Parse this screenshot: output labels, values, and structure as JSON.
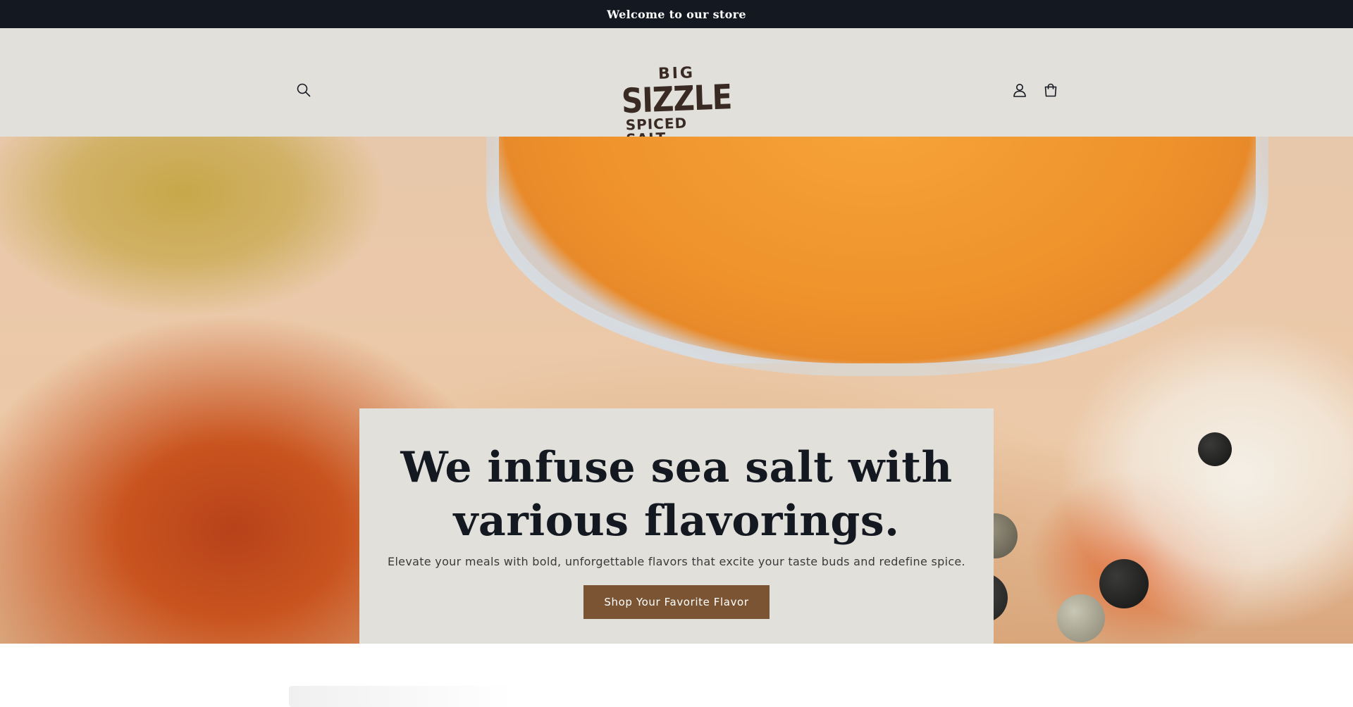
{
  "announcement": {
    "text": "Welcome to our store"
  },
  "header": {
    "logo": {
      "line1": "BIG",
      "line2": "SIZZLE",
      "line3": "SPICED SALT"
    },
    "icons": {
      "search": "search-icon",
      "account": "user-icon",
      "cart": "cart-icon"
    }
  },
  "hero": {
    "title": "We infuse sea salt with various flavorings.",
    "subtitle": "Elevate your meals with bold, unforgettable flavors that excite your taste buds and redefine spice.",
    "button_label": "Shop Your Favorite Flavor"
  },
  "colors": {
    "announcement_bg": "#131821",
    "header_bg": "#e2e0db",
    "button_bg": "#7b5533",
    "title_text": "#141820",
    "logo_brown": "#3a2a24"
  }
}
